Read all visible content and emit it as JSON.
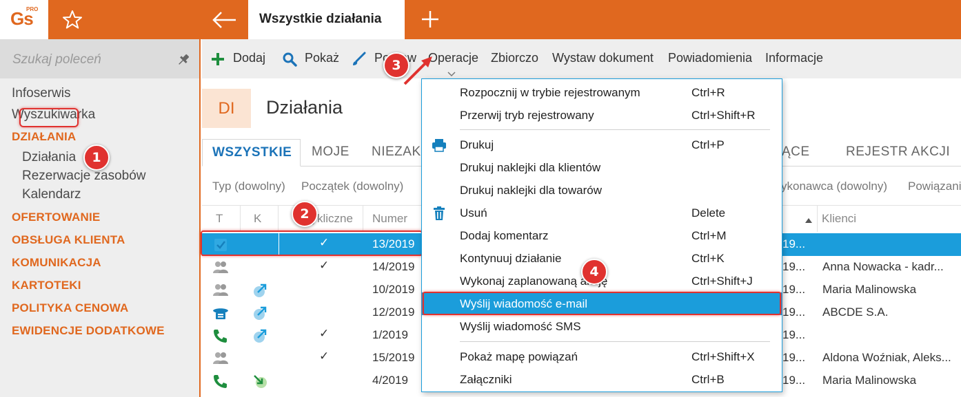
{
  "app": {
    "logo_text": "Gs",
    "logo_badge": "PRO",
    "active_tab_label": "Wszystkie działania"
  },
  "sidebar": {
    "search_placeholder": "Szukaj poleceń",
    "items": [
      {
        "label": "Infoserwis",
        "kind": "plain"
      },
      {
        "label": "Wyszukiwarka",
        "kind": "plain"
      },
      {
        "label": "DZIAŁANIA",
        "kind": "section"
      },
      {
        "label": "Działania",
        "kind": "sub",
        "selected": true
      },
      {
        "label": "Rezerwacje zasobów",
        "kind": "sub"
      },
      {
        "label": "Kalendarz",
        "kind": "sub"
      },
      {
        "label": "OFERTOWANIE",
        "kind": "section"
      },
      {
        "label": "OBSŁUGA KLIENTA",
        "kind": "section"
      },
      {
        "label": "KOMUNIKACJA",
        "kind": "section"
      },
      {
        "label": "KARTOTEKI",
        "kind": "section"
      },
      {
        "label": "POLITYKA CENOWA",
        "kind": "section"
      },
      {
        "label": "EWIDENCJE DODATKOWE",
        "kind": "section"
      }
    ]
  },
  "toolbar": {
    "add": "Dodaj",
    "show": "Pokaż",
    "edit": "Popraw",
    "operations": "Operacje",
    "summary": "Zbiorczo",
    "issue_document": "Wystaw dokument",
    "notifications": "Powiadomienia",
    "information": "Informacje"
  },
  "header": {
    "badge": "DI",
    "title": "Działania"
  },
  "tabs": {
    "all": "WSZYSTKIE",
    "mine": "MOJE",
    "incomplete_partial": "NIEZAKO",
    "current_partial": "ĄCE",
    "action_register": "REJESTR AKCJI"
  },
  "filters": {
    "type": "Typ (dowolny)",
    "start": "Początek (dowolny)",
    "executor_partial": "ykonawca (dowolny)",
    "relations_partial": "Powiązani"
  },
  "grid": {
    "columns": {
      "t": "T",
      "k": "K",
      "cyclic_partial": "cykliczne",
      "number": "Numer",
      "clients": "Klienci"
    },
    "rows": [
      {
        "number": "13/2019",
        "cyclic": true,
        "date_partial": "19...",
        "clients": "",
        "t_icon": "checkbox-icon",
        "k_icon": "",
        "selected": true
      },
      {
        "number": "14/2019",
        "cyclic": true,
        "date_partial": "19...",
        "clients": "Anna Nowacka - kadr...",
        "t_icon": "meeting-icon",
        "k_icon": ""
      },
      {
        "number": "10/2019",
        "cyclic": false,
        "date_partial": "19...",
        "clients": "Maria Malinowska",
        "t_icon": "meeting-icon",
        "k_icon": "outgoing-icon"
      },
      {
        "number": "12/2019",
        "cyclic": false,
        "date_partial": "19...",
        "clients": "ABCDE S.A.",
        "t_icon": "fax-icon",
        "k_icon": "outgoing-icon"
      },
      {
        "number": "1/2019",
        "cyclic": true,
        "date_partial": "19...",
        "clients": "",
        "t_icon": "phone-icon",
        "k_icon": "outgoing-icon"
      },
      {
        "number": "15/2019",
        "cyclic": true,
        "date_partial": "19...",
        "clients": "Aldona Woźniak, Aleks...",
        "t_icon": "meeting-icon",
        "k_icon": ""
      },
      {
        "number": "4/2019",
        "cyclic": false,
        "date_partial": "19...",
        "clients": "Maria Malinowska",
        "t_icon": "phone-icon",
        "k_icon": "incoming-icon"
      }
    ]
  },
  "operations_menu": {
    "items": [
      {
        "label": "Rozpocznij w trybie rejestrowanym",
        "shortcut": "Ctrl+R",
        "icon": ""
      },
      {
        "label": "Przerwij tryb rejestrowany",
        "shortcut": "Ctrl+Shift+R",
        "icon": ""
      },
      {
        "label": "Drukuj",
        "shortcut": "Ctrl+P",
        "icon": "printer-icon"
      },
      {
        "label": "Drukuj naklejki dla klientów",
        "shortcut": "",
        "icon": ""
      },
      {
        "label": "Drukuj naklejki dla towarów",
        "shortcut": "",
        "icon": ""
      },
      {
        "label": "Usuń",
        "shortcut": "Delete",
        "icon": "trash-icon"
      },
      {
        "label": "Dodaj komentarz",
        "shortcut": "Ctrl+M",
        "icon": ""
      },
      {
        "label": "Kontynuuj działanie",
        "shortcut": "Ctrl+K",
        "icon": ""
      },
      {
        "label": "Wykonaj zaplanowaną akcję",
        "shortcut": "Ctrl+Shift+J",
        "icon": ""
      },
      {
        "label": "Wyślij wiadomość e-mail",
        "shortcut": "",
        "icon": "",
        "active": true
      },
      {
        "label": "Wyślij wiadomość SMS",
        "shortcut": "",
        "icon": ""
      },
      {
        "label": "Pokaż mapę powiązań",
        "shortcut": "Ctrl+Shift+X",
        "icon": ""
      },
      {
        "label": "Załączniki",
        "shortcut": "Ctrl+B",
        "icon": ""
      }
    ]
  },
  "step_markers": [
    "1",
    "2",
    "3",
    "4"
  ],
  "colors": {
    "brand_orange": "#E0681F",
    "selection_blue": "#1B9DDB",
    "tab_blue": "#1B73B8",
    "marker_red": "#E0322F",
    "green_icon": "#1E8E3E"
  }
}
